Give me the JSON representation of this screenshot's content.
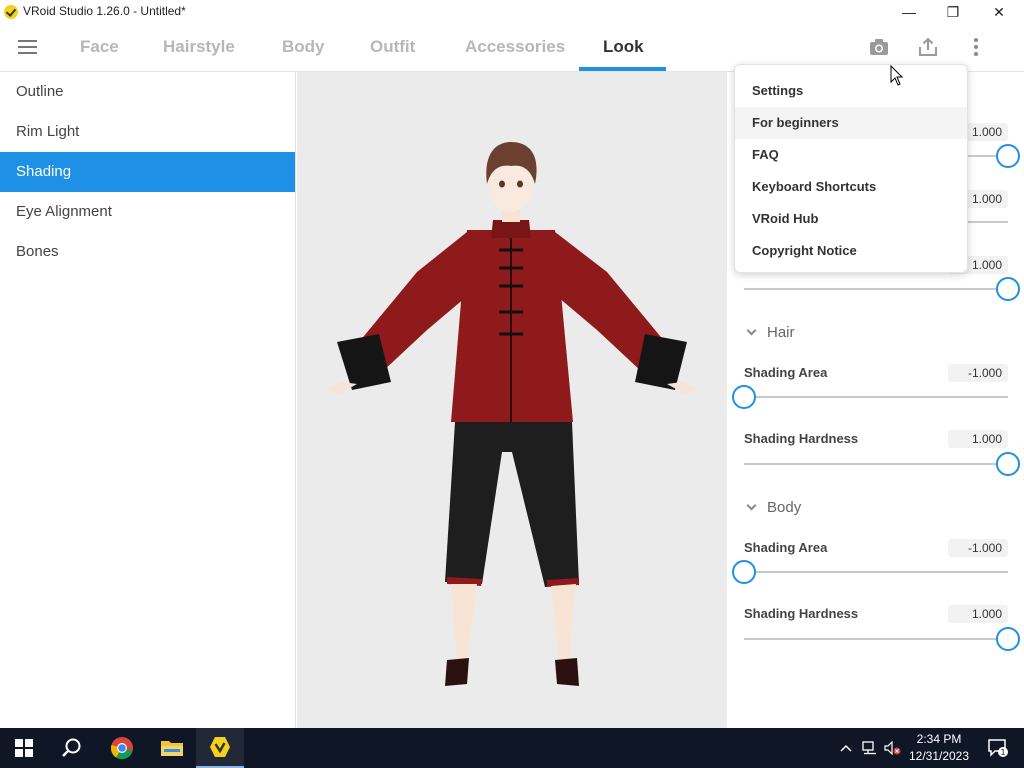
{
  "window": {
    "title": "VRoid Studio 1.26.0 - Untitled*",
    "minimize_glyph": "—",
    "maximize_glyph": "❐",
    "close_glyph": "✕"
  },
  "tabs": [
    {
      "label": "Face"
    },
    {
      "label": "Hairstyle"
    },
    {
      "label": "Body"
    },
    {
      "label": "Outfit"
    },
    {
      "label": "Accessories"
    },
    {
      "label": "Look",
      "active": true
    }
  ],
  "toolbar_icons": [
    "camera-icon",
    "export-icon",
    "more-vertical-icon"
  ],
  "left_menu": [
    {
      "label": "Outline"
    },
    {
      "label": "Rim Light"
    },
    {
      "label": "Shading",
      "active": true
    },
    {
      "label": "Eye Alignment"
    },
    {
      "label": "Bones"
    }
  ],
  "right_panel": {
    "hidden_values": [
      "1.000",
      "1.000",
      "1.000"
    ],
    "hidden_slider_levels": [
      1.0,
      1.0,
      1.0
    ],
    "hair": {
      "header": "Hair",
      "shading_area_label": "Shading Area",
      "shading_area_value": "-1.000",
      "shading_area_level": 0.0,
      "shading_hardness_label": "Shading Hardness",
      "shading_hardness_value": "1.000",
      "shading_hardness_level": 1.0
    },
    "body": {
      "header": "Body",
      "shading_area_label": "Shading Area",
      "shading_area_value": "-1.000",
      "shading_area_level": 0.0,
      "shading_hardness_label": "Shading Hardness",
      "shading_hardness_value": "1.000",
      "shading_hardness_level": 1.0
    }
  },
  "dropdown_menu": [
    {
      "label": "Settings"
    },
    {
      "label": "For beginners",
      "hovered": true
    },
    {
      "label": "FAQ"
    },
    {
      "label": "Keyboard Shortcuts"
    },
    {
      "label": "VRoid Hub"
    },
    {
      "label": "Copyright Notice"
    }
  ],
  "taskbar": {
    "time": "2:34 PM",
    "date": "12/31/2023",
    "notification_count": "1"
  },
  "colors": {
    "accent": "#1e90e6",
    "jacket": "#8e1a1c",
    "pants": "#1e1e1e",
    "viewport_bg": "#ebebeb",
    "taskbar_bg": "#0f1626"
  }
}
